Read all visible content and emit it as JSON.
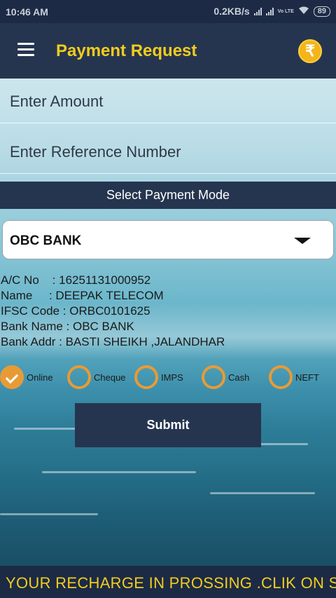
{
  "status_bar": {
    "time": "10:46 AM",
    "network_speed": "0.2KB/s",
    "volte": "Vo LTE",
    "battery": "89"
  },
  "app_bar": {
    "title": "Payment Request",
    "menu_icon": "hamburger-menu-icon",
    "wallet_icon": "rupee-icon"
  },
  "form": {
    "amount_placeholder": "Enter Amount",
    "amount_value": "",
    "reference_placeholder": "Enter Reference Number",
    "reference_value": ""
  },
  "payment_mode": {
    "header": "Select Payment Mode",
    "selected_bank": "OBC BANK"
  },
  "bank_details": {
    "account_no": "A/C No    : 16251131000952",
    "name": "Name     : DEEPAK TELECOM",
    "ifsc": "IFSC Code : ORBC0101625",
    "bank_name": "Bank Name : OBC BANK",
    "bank_addr": "Bank Addr : BASTI SHEIKH ,JALANDHAR"
  },
  "modes": [
    {
      "label": "Online",
      "checked": true
    },
    {
      "label": "Cheque",
      "checked": false
    },
    {
      "label": "IMPS",
      "checked": false
    },
    {
      "label": "Cash",
      "checked": false
    },
    {
      "label": "NEFT",
      "checked": false
    }
  ],
  "submit_label": "Submit",
  "ticker": "YOUR RECHARGE IN PROSSING .CLIK ON S",
  "colors": {
    "primary": "#26354f",
    "accent": "#f2cc1e",
    "radio": "#e79b37"
  }
}
